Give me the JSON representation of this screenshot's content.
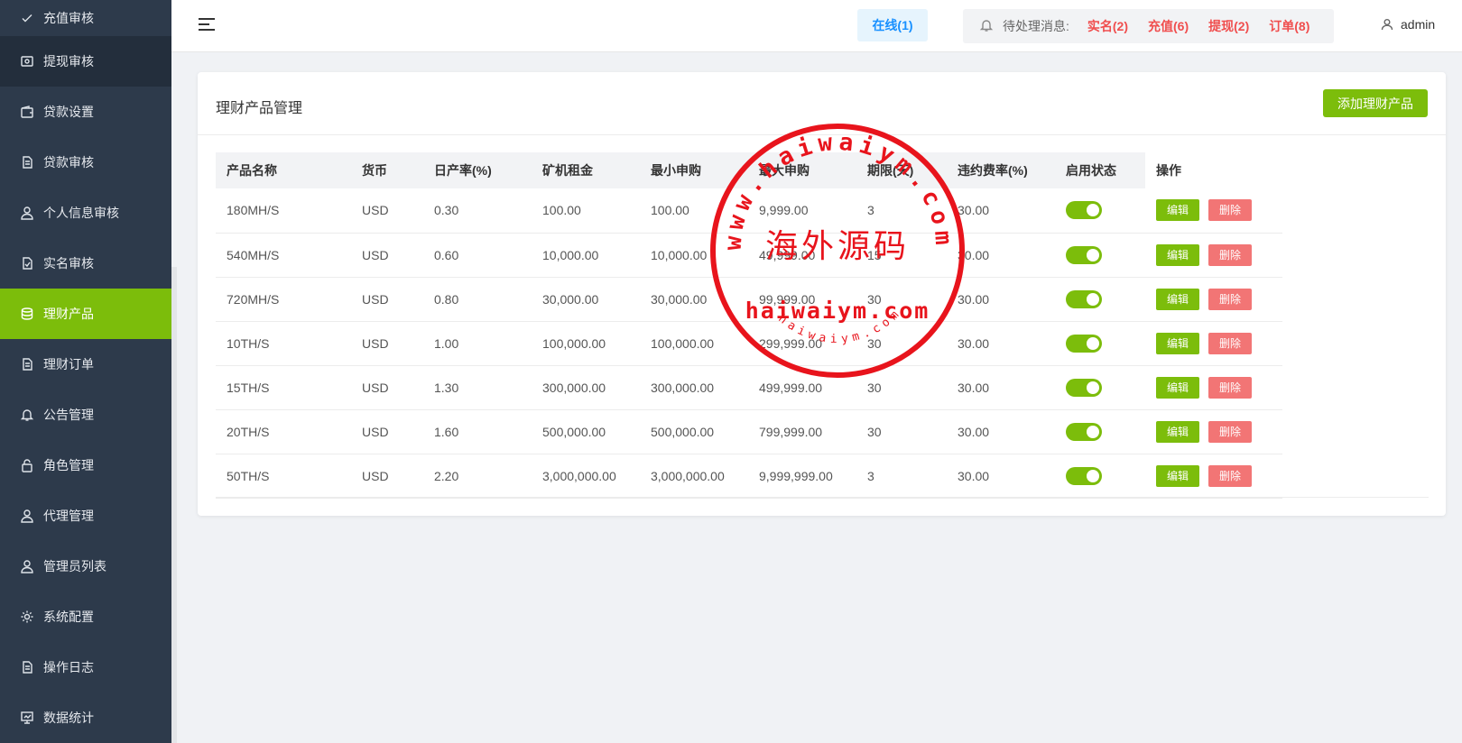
{
  "sidebar": {
    "items": [
      {
        "label": "充值审核",
        "icon": "check-icon"
      },
      {
        "label": "提现审核",
        "icon": "withdraw-icon"
      },
      {
        "label": "贷款设置",
        "icon": "wallet-icon"
      },
      {
        "label": "贷款审核",
        "icon": "document-icon"
      },
      {
        "label": "个人信息审核",
        "icon": "user-icon"
      },
      {
        "label": "实名审核",
        "icon": "verify-document-icon"
      },
      {
        "label": "理财产品",
        "icon": "database-icon"
      },
      {
        "label": "理财订单",
        "icon": "document-icon"
      },
      {
        "label": "公告管理",
        "icon": "bell-icon"
      },
      {
        "label": "角色管理",
        "icon": "lock-icon"
      },
      {
        "label": "代理管理",
        "icon": "user-icon"
      },
      {
        "label": "管理员列表",
        "icon": "user-icon"
      },
      {
        "label": "系统配置",
        "icon": "gear-icon"
      },
      {
        "label": "操作日志",
        "icon": "document-icon"
      },
      {
        "label": "数据统计",
        "icon": "chart-icon"
      }
    ],
    "active_index": 6
  },
  "header": {
    "online": "在线(1)",
    "pending_label": "待处理消息:",
    "pending_links": [
      "实名(2)",
      "充值(6)",
      "提现(2)",
      "订单(8)"
    ],
    "user": "admin"
  },
  "card": {
    "title": "理财产品管理",
    "add_button": "添加理财产品"
  },
  "table": {
    "headers": [
      "产品名称",
      "货币",
      "日产率(%)",
      "矿机租金",
      "最小申购",
      "最大申购",
      "期限(天)",
      "违约费率(%)",
      "启用状态",
      "操作"
    ],
    "rows": [
      [
        "180MH/S",
        "USD",
        "0.30",
        "100.00",
        "100.00",
        "9,999.00",
        "3",
        "30.00"
      ],
      [
        "540MH/S",
        "USD",
        "0.60",
        "10,000.00",
        "10,000.00",
        "49,999.00",
        "15",
        "30.00"
      ],
      [
        "720MH/S",
        "USD",
        "0.80",
        "30,000.00",
        "30,000.00",
        "99,999.00",
        "30",
        "30.00"
      ],
      [
        "10TH/S",
        "USD",
        "1.00",
        "100,000.00",
        "100,000.00",
        "299,999.00",
        "30",
        "30.00"
      ],
      [
        "15TH/S",
        "USD",
        "1.30",
        "300,000.00",
        "300,000.00",
        "499,999.00",
        "30",
        "30.00"
      ],
      [
        "20TH/S",
        "USD",
        "1.60",
        "500,000.00",
        "500,000.00",
        "799,999.00",
        "30",
        "30.00"
      ],
      [
        "50TH/S",
        "USD",
        "2.20",
        "3,000,000.00",
        "3,000,000.00",
        "9,999,999.00",
        "3",
        "30.00"
      ]
    ],
    "enabled": [
      true,
      true,
      true,
      true,
      true,
      true,
      true
    ],
    "edit_label": "编辑",
    "delete_label": "删除"
  },
  "watermark": {
    "ring_text": "www.haiwaiym.com",
    "center_text": "海外源码",
    "domain_text": "haiwaiym.com",
    "small_text": "haiwaiym.com",
    "color": "#e8141c"
  },
  "colors": {
    "accent": "#7cbd0b",
    "sidebar": "#2d3a4b",
    "danger": "#f27575",
    "link_red": "#f04e4e",
    "online_blue": "#1890ff"
  }
}
